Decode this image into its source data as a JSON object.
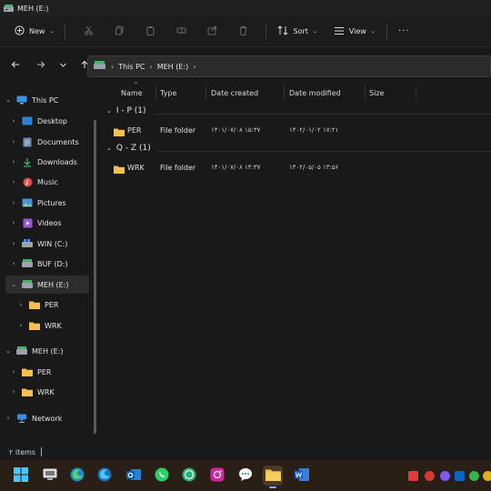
{
  "window": {
    "title": "MEH (E:)"
  },
  "toolbar": {
    "new_label": "New",
    "sort_label": "Sort",
    "view_label": "View",
    "more_label": "···"
  },
  "address": {
    "crumbs": [
      "This PC",
      "MEH (E:)"
    ]
  },
  "sidebar": {
    "items": [
      {
        "label": "This PC"
      },
      {
        "label": "Desktop"
      },
      {
        "label": "Documents"
      },
      {
        "label": "Downloads"
      },
      {
        "label": "Music"
      },
      {
        "label": "Pictures"
      },
      {
        "label": "Videos"
      },
      {
        "label": "WIN (C:)"
      },
      {
        "label": "BUF (D:)"
      },
      {
        "label": "MEH (E:)"
      },
      {
        "label": "PER"
      },
      {
        "label": "WRK"
      },
      {
        "label": "MEH (E:)"
      },
      {
        "label": "PER"
      },
      {
        "label": "WRK"
      },
      {
        "label": "Network"
      }
    ]
  },
  "columns": {
    "name": "Name",
    "type": "Type",
    "date_created": "Date created",
    "date_modified": "Date modified",
    "size": "Size"
  },
  "groups": [
    {
      "title": "I - P (1)",
      "rows": [
        {
          "name": "PER",
          "type": "File folder",
          "created": "۱۴۰۱/۰۷/۰۸ ۱۵:۳۷",
          "modified": "۱۴۰۲/۰۱/۰۲ ۱۷:۲۱"
        }
      ]
    },
    {
      "title": "Q - Z (1)",
      "rows": [
        {
          "name": "WRK",
          "type": "File folder",
          "created": "۱۴۰۱/۰۷/۰۸ ۱۴:۳۷",
          "modified": "۱۴۰۲/۰۵/۰۵ ۱۳:۵۶"
        }
      ]
    }
  ],
  "status": {
    "items_text": "۲ items"
  },
  "colors": {
    "folder": "#f4c04e",
    "accent": "#6fb3ff",
    "background": "#191919"
  }
}
